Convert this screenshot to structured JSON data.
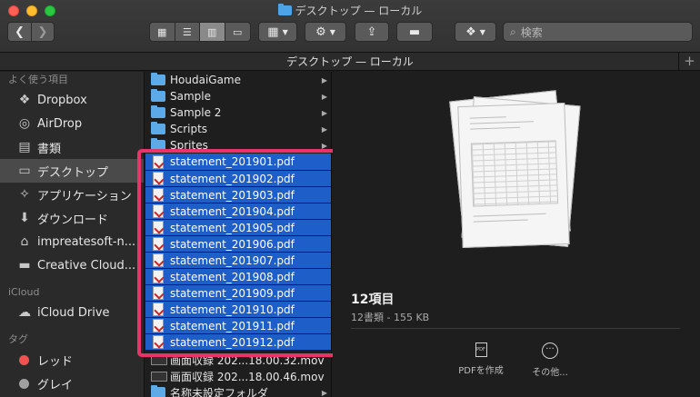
{
  "window": {
    "title": "デスクトップ — ローカル"
  },
  "pathbar": {
    "title": "デスクトップ — ローカル",
    "plus": "+"
  },
  "search": {
    "placeholder": "検索",
    "icon": "search-icon"
  },
  "toolbar": {
    "back": "❮",
    "forward": "❯",
    "view_icons": "▦",
    "view_list": "☰",
    "view_columns": "▥",
    "view_gallery": "▭",
    "group": "▦",
    "action": "⚙",
    "share": "⇪",
    "tag": "▬",
    "dropbox": "❖"
  },
  "sidebar": {
    "favorites_title": "よく使う項目",
    "favorites": [
      {
        "label": "Dropbox",
        "icon": "❖"
      },
      {
        "label": "AirDrop",
        "icon": "◎"
      },
      {
        "label": "書類",
        "icon": "▤"
      },
      {
        "label": "デスクトップ",
        "icon": "▭"
      },
      {
        "label": "アプリケーション",
        "icon": "✧"
      },
      {
        "label": "ダウンロード",
        "icon": "⬇"
      },
      {
        "label": "impreatesoft-n...",
        "icon": "⌂"
      },
      {
        "label": "Creative Cloud...",
        "icon": "▬"
      }
    ],
    "icloud_title": "iCloud",
    "icloud": [
      {
        "label": "iCloud Drive",
        "icon": "☁"
      }
    ],
    "tags_title": "タグ",
    "tags": [
      {
        "label": "レッド",
        "color": "#f0524f"
      },
      {
        "label": "グレイ",
        "color": "#a0a0a0"
      }
    ]
  },
  "column": {
    "folders_top": [
      "HoudaiGame",
      "Sample",
      "Sample 2",
      "Scripts",
      "Sprites"
    ],
    "selected_files": [
      "statement_201901.pdf",
      "statement_201902.pdf",
      "statement_201903.pdf",
      "statement_201904.pdf",
      "statement_201905.pdf",
      "statement_201906.pdf",
      "statement_201907.pdf",
      "statement_201908.pdf",
      "statement_201909.pdf",
      "statement_201910.pdf",
      "statement_201911.pdf",
      "statement_201912.pdf"
    ],
    "movies": [
      "画面収録 202...18.00.32.mov",
      "画面収録 202...18.00.46.mov"
    ],
    "folders_bottom": [
      "名称未設定フォルダ"
    ]
  },
  "preview": {
    "title": "12項目",
    "subtitle": "12書類 - 155 KB",
    "pdf_badge": "PDF",
    "more_icon": "···",
    "create_pdf_label": "PDFを作成",
    "more_label": "その他..."
  },
  "colors": {
    "selection": "#1e5ec8",
    "highlight": "#e8336b",
    "folder": "#5caae8"
  }
}
